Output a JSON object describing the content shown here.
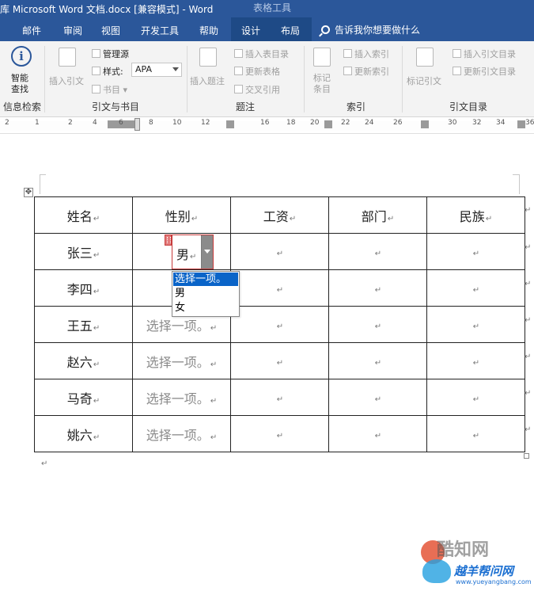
{
  "window": {
    "title": "库 Microsoft Word 文档.docx [兼容模式] - Word",
    "context_tab_label": "表格工具"
  },
  "tabs": [
    "邮件",
    "审阅",
    "视图",
    "开发工具",
    "帮助",
    "设计",
    "布局"
  ],
  "tell_me": "告诉我你想要做什么",
  "ribbon": {
    "info": {
      "button": "智能\n查找",
      "group": "信息检索"
    },
    "citations": {
      "insert_citation": "插入引文",
      "manage_sources": "管理源",
      "style_label": "样式:",
      "style_value": "APA",
      "bibliography": "书目",
      "group": "引文与书目"
    },
    "captions": {
      "insert_caption": "插入题注",
      "insert_table_of_figures": "插入表目录",
      "update_table": "更新表格",
      "cross_reference": "交叉引用",
      "group": "题注"
    },
    "index": {
      "mark_entry": "标记\n条目",
      "insert_index": "插入索引",
      "update_index": "更新索引",
      "group": "索引"
    },
    "toa": {
      "mark_citation": "标记引文",
      "insert_toa": "插入引文目录",
      "update_toa": "更新引文目录",
      "group": "引文目录"
    }
  },
  "ruler": {
    "ticks": [
      "2",
      "1",
      "2",
      "4",
      "6",
      "8",
      "10",
      "12",
      "16",
      "18",
      "20",
      "22",
      "24",
      "26",
      "30",
      "32",
      "34",
      "36",
      "38"
    ]
  },
  "table": {
    "headers": [
      "姓名",
      "性别",
      "工资",
      "部门",
      "民族"
    ],
    "rows": [
      {
        "name": "张三",
        "gender": "男"
      },
      {
        "name": "李四",
        "gender": ""
      },
      {
        "name": "王五",
        "gender": "选择一项。"
      },
      {
        "name": "赵六",
        "gender": "选择一项。"
      },
      {
        "name": "马奇",
        "gender": "选择一项。"
      },
      {
        "name": "姚六",
        "gender": "选择一项。"
      }
    ],
    "cell_mark": "↵"
  },
  "combo_box": {
    "current_value": "男",
    "options": [
      "选择一项。",
      "男",
      "女"
    ],
    "selected_index": 0
  },
  "watermark": {
    "line1": "酷知网",
    "line2": "越羊帮问网",
    "url": "www.yueyangbang.com"
  },
  "colors": {
    "ribbon_blue": "#2b579a",
    "selection_blue": "#0a64c8",
    "control_border": "#c73b3b"
  }
}
